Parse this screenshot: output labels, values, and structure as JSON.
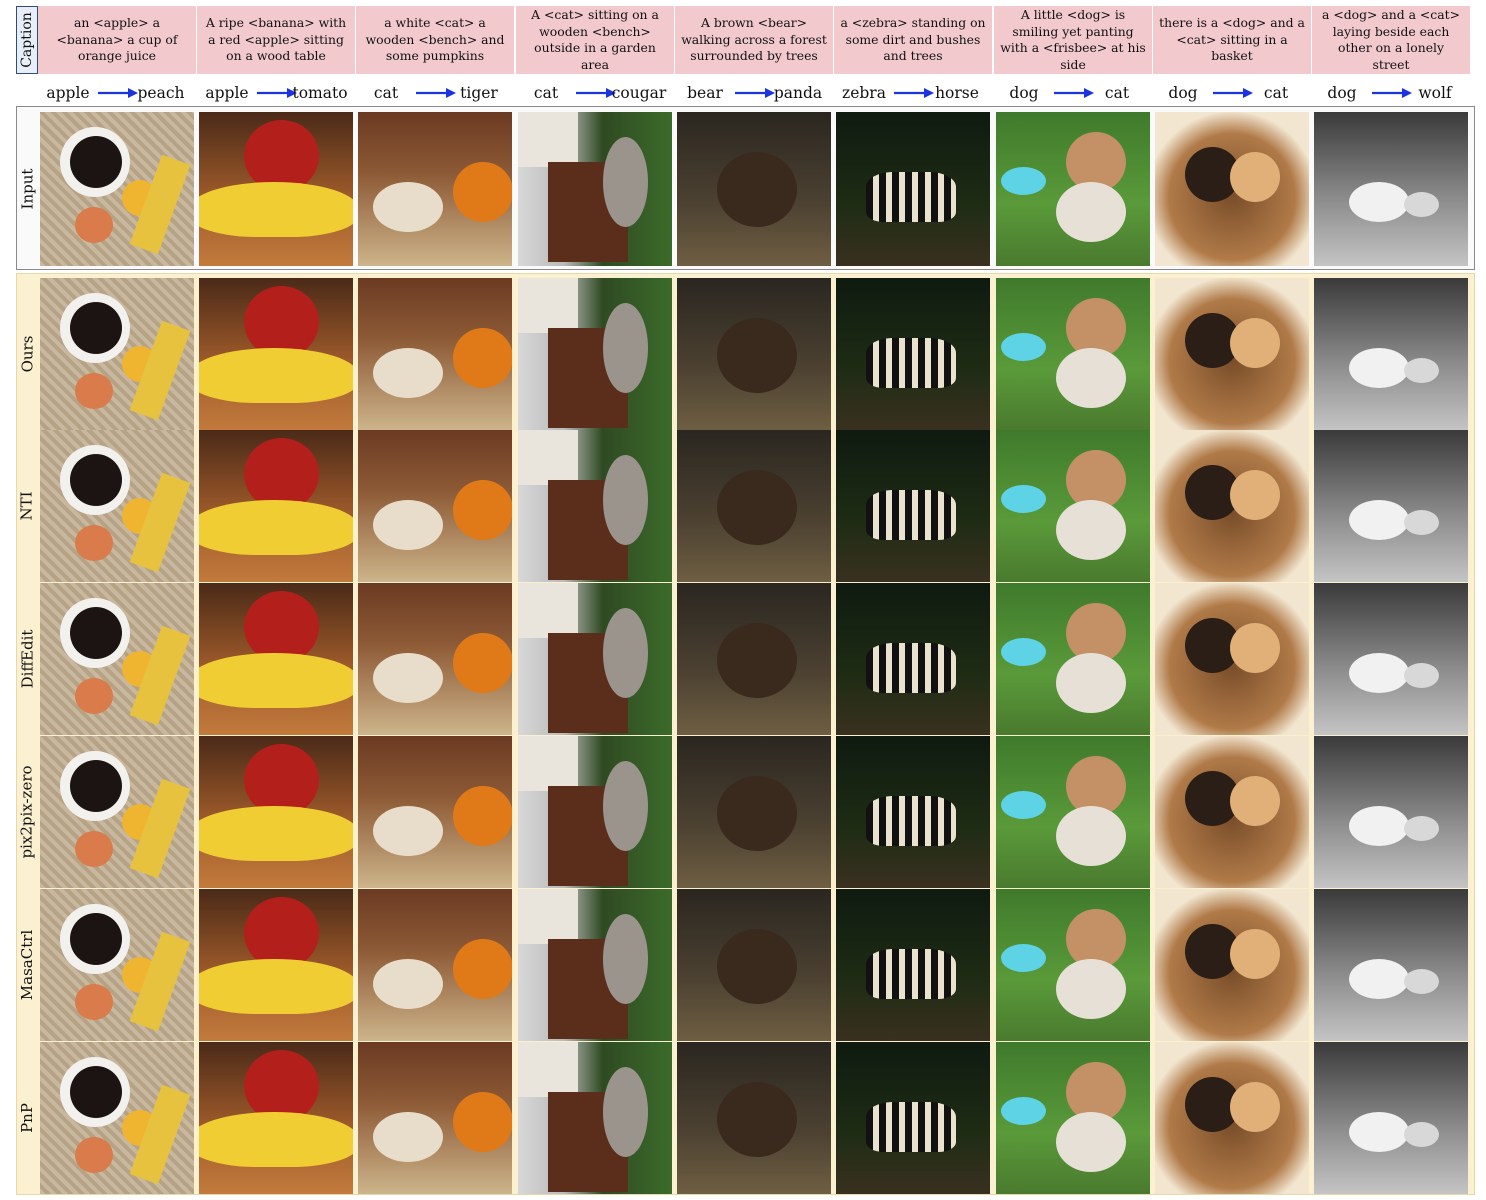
{
  "caption_label": "Caption",
  "captions": [
    "an <apple> a <banana> a cup of orange juice",
    "A ripe <banana> with a red <apple> sitting on a wood table",
    "a white <cat> a wooden <bench> and some pumpkins",
    "A <cat> sitting on a wooden <bench> outside in a garden area",
    "A brown <bear> walking across a forest surrounded by trees",
    "a <zebra> standing on some dirt and bushes and trees",
    "A little <dog> is smiling yet panting with a <frisbee> at his side",
    "there is a <dog> and a <cat> sitting in a basket",
    "a <dog> and a <cat> laying beside each other on a lonely street"
  ],
  "edits": [
    {
      "src": "apple",
      "dst": "peach"
    },
    {
      "src": "apple",
      "dst": "tomato"
    },
    {
      "src": "cat",
      "dst": "tiger"
    },
    {
      "src": "cat",
      "dst": "cougar"
    },
    {
      "src": "bear",
      "dst": "panda"
    },
    {
      "src": "zebra",
      "dst": "horse"
    },
    {
      "src": "dog",
      "dst": "cat"
    },
    {
      "src": "dog",
      "dst": "cat"
    },
    {
      "src": "dog",
      "dst": "wolf"
    }
  ],
  "rows": [
    "Input",
    "Ours",
    "NTI",
    "DiffEdit",
    "pix2pix-zero",
    "MasaCtrl",
    "PnP"
  ],
  "colors": {
    "caption_bg": "#f2c9cc",
    "arrow": "#1a35e0",
    "method_bg": "#fbf0d0",
    "caption_label_border": "#2f4c7a"
  }
}
